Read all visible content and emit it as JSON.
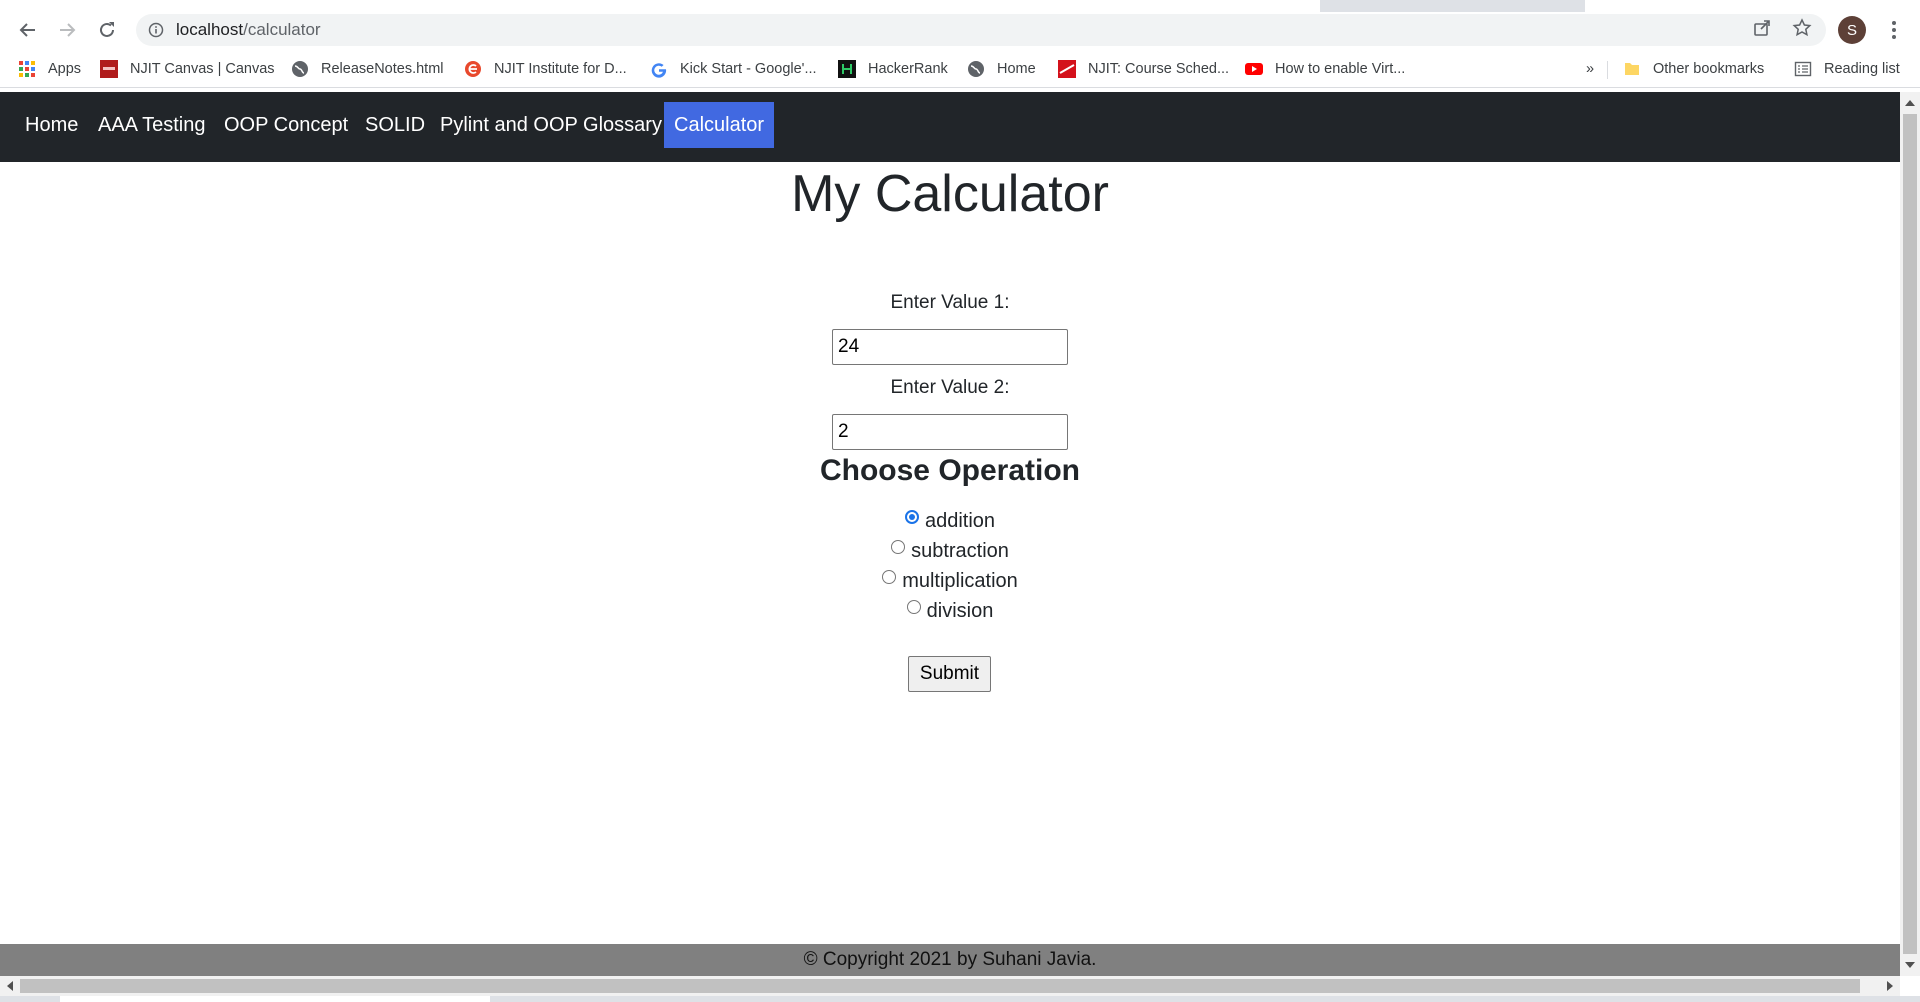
{
  "browser": {
    "url_host": "localhost",
    "url_path": "/calculator",
    "profile_initial": "S",
    "bookmarks": [
      {
        "label": "Apps",
        "icon": "apps-grid-icon"
      },
      {
        "label": "NJIT Canvas | Canvas",
        "icon": "njit-canvas-icon"
      },
      {
        "label": "ReleaseNotes.html",
        "icon": "globe-icon"
      },
      {
        "label": "NJIT Institute for D...",
        "icon": "njit-institute-icon"
      },
      {
        "label": "Kick Start - Google'...",
        "icon": "google-icon"
      },
      {
        "label": "HackerRank",
        "icon": "hackerrank-icon"
      },
      {
        "label": "Home",
        "icon": "globe-icon"
      },
      {
        "label": "NJIT: Course Sched...",
        "icon": "njit-course-icon"
      },
      {
        "label": "How to enable Virt...",
        "icon": "youtube-icon"
      }
    ],
    "overflow_label": "»",
    "other_bookmarks": "Other bookmarks",
    "reading_list": "Reading list"
  },
  "site_nav": {
    "links": [
      "Home",
      "AAA Testing",
      "OOP Concept",
      "SOLID",
      "Pylint and OOP Glossary",
      "Calculator"
    ],
    "active": "Calculator",
    "active_color": "#4169e1",
    "bg_color": "#212529"
  },
  "calculator": {
    "title": "My Calculator",
    "value1_label": "Enter Value 1:",
    "value1": "24",
    "value2_label": "Enter Value 2:",
    "value2": "2",
    "operation_heading": "Choose Operation",
    "operations": [
      "addition",
      "subtraction",
      "multiplication",
      "division"
    ],
    "selected_operation": "addition",
    "submit_label": "Submit"
  },
  "footer": {
    "text": "© Copyright 2021 by Suhani Javia."
  }
}
